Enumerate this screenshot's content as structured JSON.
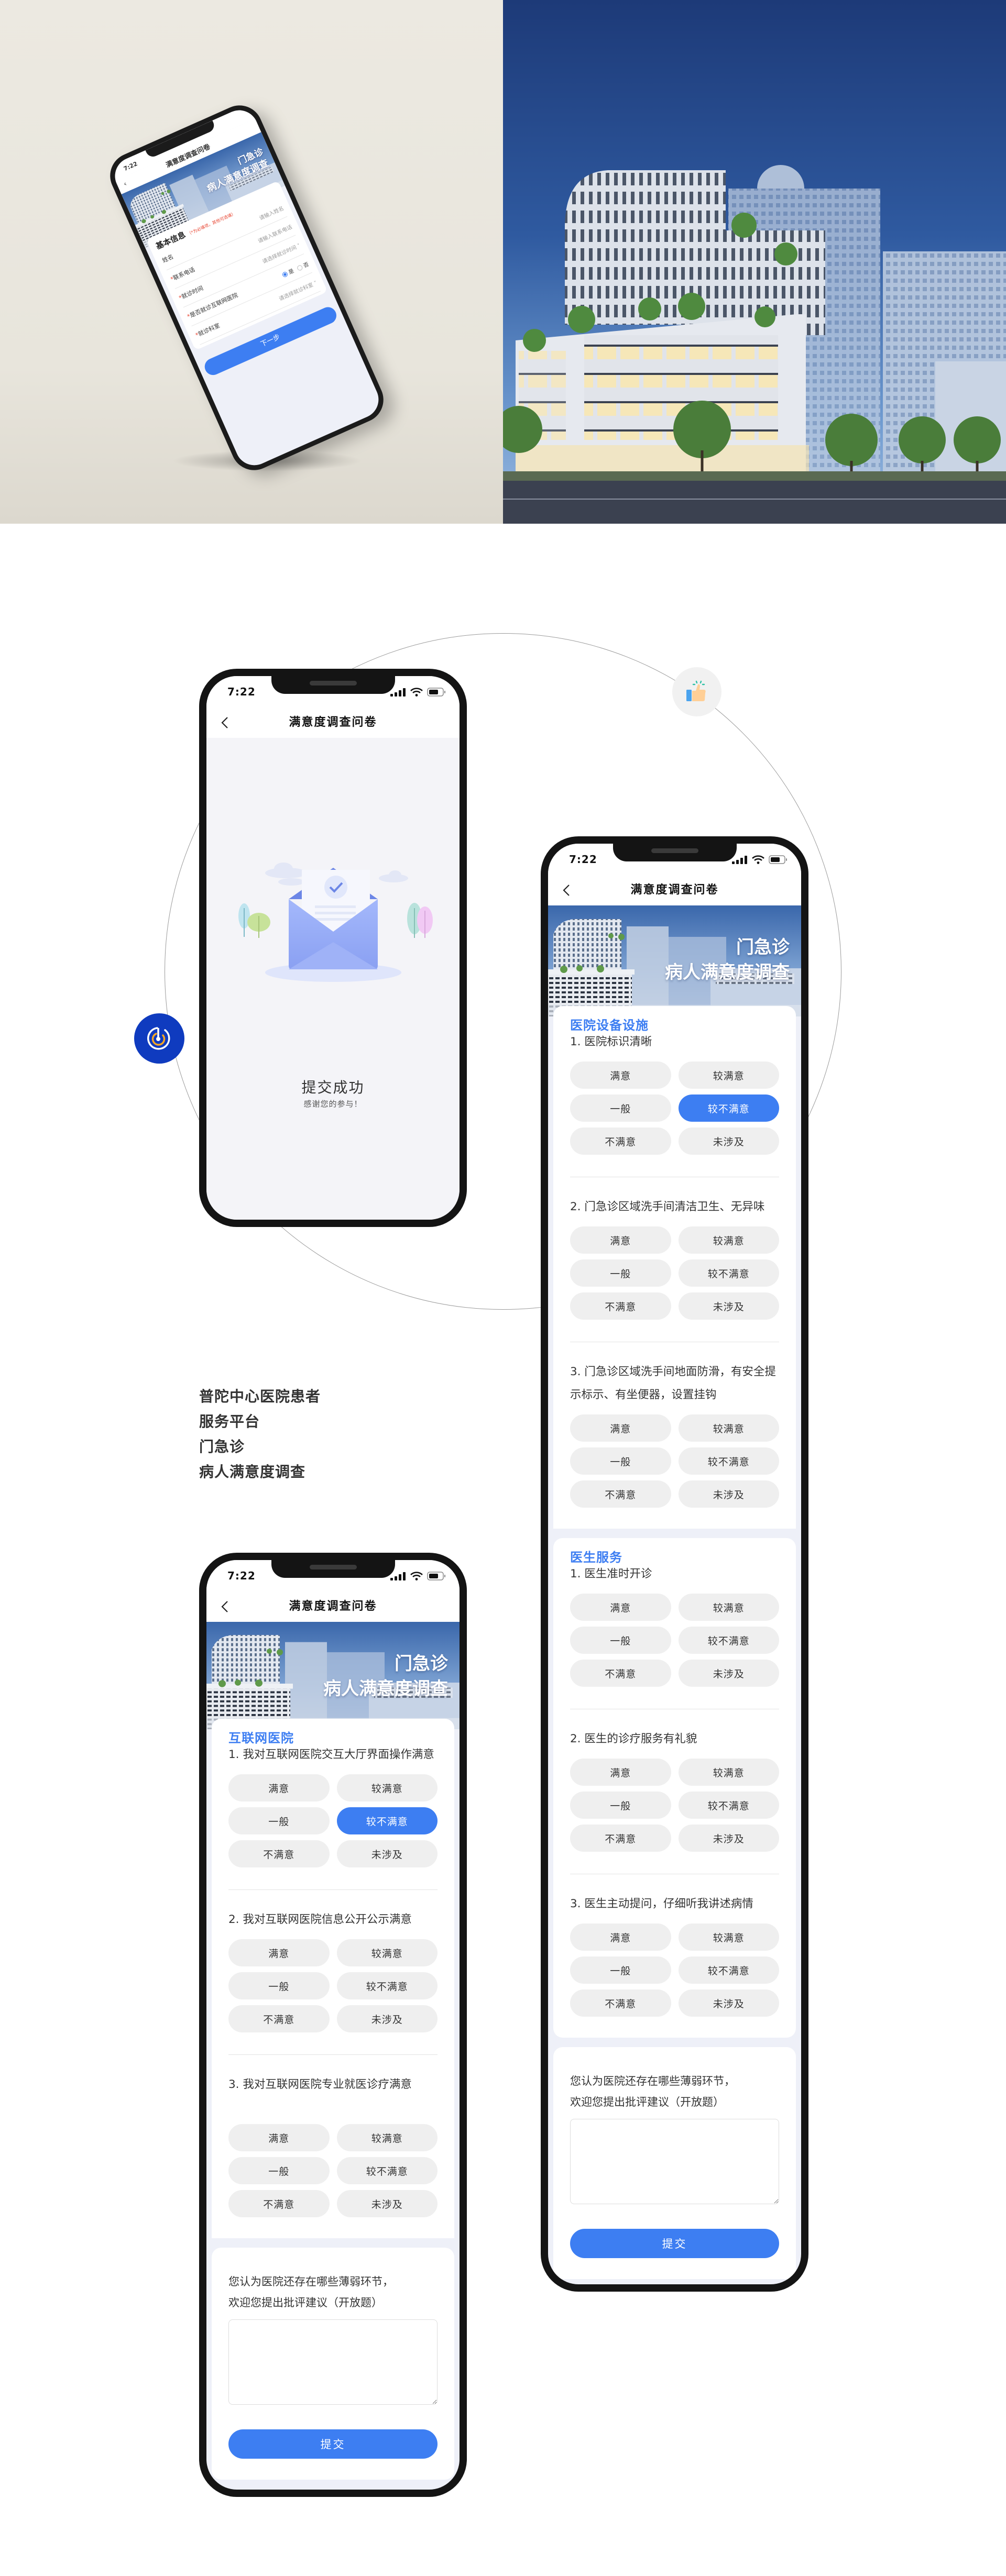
{
  "status_time": "7:22",
  "nav_title": "满意度调查问卷",
  "banner": {
    "line1": "门急诊",
    "line2": "病人满意度调查"
  },
  "rating_options": [
    "满意",
    "较满意",
    "一般",
    "较不满意",
    "不满意",
    "未涉及"
  ],
  "colors": {
    "accent": "#3d7ef2",
    "required": "#e8432f",
    "option_bg": "#efefef",
    "page_bg": "#eef0f8",
    "badge_blue": "#0f3bbf"
  },
  "icons": {
    "back": "chevron-left-icon",
    "signal": "signal-icon",
    "wifi": "wifi-icon",
    "battery": "battery-icon",
    "thumb": "thumbs-up-icon",
    "power": "power-icon",
    "success": "envelope-check-illustration"
  },
  "basic_info_mockup": {
    "section_title": "基本信息",
    "required_hint": "（*为必填项，其他可选填）",
    "fields": [
      {
        "label": "姓名",
        "required": false,
        "type": "text",
        "placeholder": "请输入姓名"
      },
      {
        "label": "联系电话",
        "required": true,
        "type": "text",
        "placeholder": "请输入联系电话"
      },
      {
        "label": "就诊时间",
        "required": true,
        "type": "select",
        "placeholder": "请选择就诊时间"
      },
      {
        "label": "是否就诊互联网医院",
        "required": true,
        "type": "radio",
        "options": [
          "是",
          "否"
        ],
        "selected": "是"
      },
      {
        "label": "就诊科室",
        "required": true,
        "type": "select",
        "placeholder": "请选择就诊科室"
      }
    ],
    "next_label": "下一步"
  },
  "success_screen": {
    "title": "提交成功",
    "subtitle": "感谢您的参与！"
  },
  "tagline": [
    "普陀中心医院患者",
    "服务平台",
    "门急诊",
    "病人满意度调查"
  ],
  "survey_outpatient": {
    "sections": [
      {
        "title": "医院设备设施",
        "questions": [
          {
            "text": "1. 医院标识清晰",
            "selected": "较不满意"
          },
          {
            "text": "2. 门急诊区域洗手间清洁卫生、无异味",
            "selected": null
          },
          {
            "text": "3. 门急诊区域洗手间地面防滑，有安全提示标示、有坐便器，设置挂钩",
            "selected": null
          }
        ]
      },
      {
        "title": "医生服务",
        "questions": [
          {
            "text": "1. 医生准时开诊",
            "selected": null
          },
          {
            "text": "2. 医生的诊疗服务有礼貌",
            "selected": null
          },
          {
            "text": "3. 医生主动提问，仔细听我讲述病情",
            "selected": null
          }
        ]
      }
    ],
    "feedback_prompt": [
      "您认为医院还存在哪些薄弱环节，",
      "欢迎您提出批评建议（开放题）"
    ],
    "feedback_value": "",
    "submit_label": "提交"
  },
  "survey_internet": {
    "sections": [
      {
        "title": "互联网医院",
        "questions": [
          {
            "text": "1. 我对互联网医院交互大厅界面操作满意",
            "selected": "较不满意"
          },
          {
            "text": "2. 我对互联网医院信息公开公示满意",
            "selected": null
          },
          {
            "text": "3. 我对互联网医院专业就医诊疗满意",
            "selected": null
          }
        ]
      }
    ],
    "feedback_prompt": [
      "您认为医院还存在哪些薄弱环节，",
      "欢迎您提出批评建议（开放题）"
    ],
    "feedback_value": "",
    "submit_label": "提交"
  }
}
